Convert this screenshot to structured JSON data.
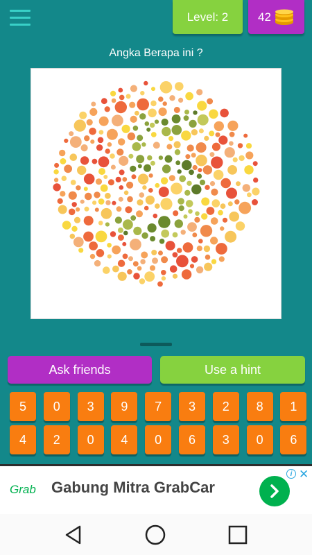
{
  "header": {
    "level_text": "Level: 2",
    "coins": "42"
  },
  "question": "Angka Berapa ini ?",
  "plate": {
    "description_icon": "ishihara-color-plate",
    "colors": {
      "background_dots": [
        "#f6a35a",
        "#f08a4b",
        "#ee6a3c",
        "#f7c65a",
        "#f9d840",
        "#f4b079",
        "#e8523a",
        "#fbd267"
      ],
      "figure_dots": [
        "#6b8a2e",
        "#8ba23d",
        "#a9b84a",
        "#5d7a2a",
        "#c3c95a"
      ]
    }
  },
  "actions": {
    "ask_friends": "Ask friends",
    "use_hint": "Use a hint"
  },
  "keypad": {
    "row1": [
      "5",
      "0",
      "3",
      "9",
      "7",
      "3",
      "2",
      "8",
      "1"
    ],
    "row2": [
      "4",
      "2",
      "0",
      "4",
      "0",
      "6",
      "3",
      "0",
      "6"
    ]
  },
  "ad": {
    "logo": "Grab",
    "text": "Gabung Mitra GrabCar",
    "info_label": "i",
    "close_label": "✕"
  },
  "colors": {
    "background": "#13888a",
    "level_green": "#86d23f",
    "coins_purple": "#b12ec5",
    "digit_orange": "#f97d10",
    "grab_green": "#00b14f"
  }
}
